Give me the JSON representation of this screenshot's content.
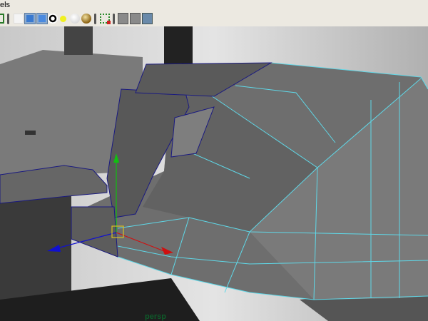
{
  "menubar": {
    "visible_label": "els"
  },
  "toolbar": {
    "icons": [
      "wireframe-icon",
      "smooth-shade-all-icon",
      "smooth-shade-selected-icon",
      "textured-icon",
      "use-default-light-icon",
      "use-all-lights-icon",
      "use-selected-lights-icon",
      "isolate-select-icon",
      "xray-icon",
      "backface-icon",
      "hud-icon"
    ]
  },
  "viewport": {
    "camera_label": "persp"
  },
  "colors": {
    "wire_selected": "#5fd8e8",
    "wire_unselected": "#1a1a80",
    "axis_x": "#d01010",
    "axis_y": "#10c010",
    "axis_z": "#1010d0",
    "manip": "#d8c020"
  }
}
